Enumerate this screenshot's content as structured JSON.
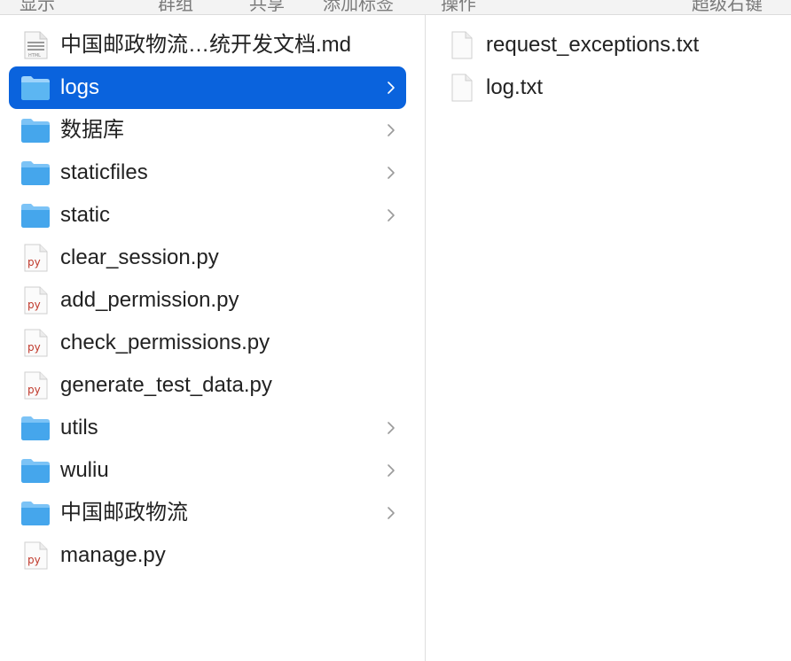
{
  "toolbar": {
    "labels": [
      "显示",
      "群组",
      "共享",
      "添加标签",
      "操作",
      "超级右键"
    ]
  },
  "left_column": {
    "items": [
      {
        "label": "中国邮政物流…统开发文档.md",
        "icon": "html-document-icon",
        "has_chevron": false
      },
      {
        "label": "logs",
        "icon": "folder-icon",
        "has_chevron": true,
        "selected": true
      },
      {
        "label": "数据库",
        "icon": "folder-icon",
        "has_chevron": true
      },
      {
        "label": "staticfiles",
        "icon": "folder-icon",
        "has_chevron": true
      },
      {
        "label": "static",
        "icon": "folder-icon",
        "has_chevron": true
      },
      {
        "label": "clear_session.py",
        "icon": "python-file-icon",
        "has_chevron": false
      },
      {
        "label": "add_permission.py",
        "icon": "python-file-icon",
        "has_chevron": false
      },
      {
        "label": "check_permissions.py",
        "icon": "python-file-icon",
        "has_chevron": false
      },
      {
        "label": "generate_test_data.py",
        "icon": "python-file-icon",
        "has_chevron": false
      },
      {
        "label": "utils",
        "icon": "folder-icon",
        "has_chevron": true
      },
      {
        "label": "wuliu",
        "icon": "folder-icon",
        "has_chevron": true
      },
      {
        "label": "中国邮政物流",
        "icon": "folder-icon",
        "has_chevron": true
      },
      {
        "label": "manage.py",
        "icon": "python-file-icon",
        "has_chevron": false
      }
    ]
  },
  "right_column": {
    "items": [
      {
        "label": "request_exceptions.txt",
        "icon": "text-file-icon"
      },
      {
        "label": "log.txt",
        "icon": "text-file-icon"
      }
    ]
  },
  "icons": {
    "py_badge": "py",
    "html_badge": "HTML"
  },
  "colors": {
    "selection": "#0a63dd",
    "folder": "#4aa8ee",
    "py_text": "#c0392b"
  }
}
